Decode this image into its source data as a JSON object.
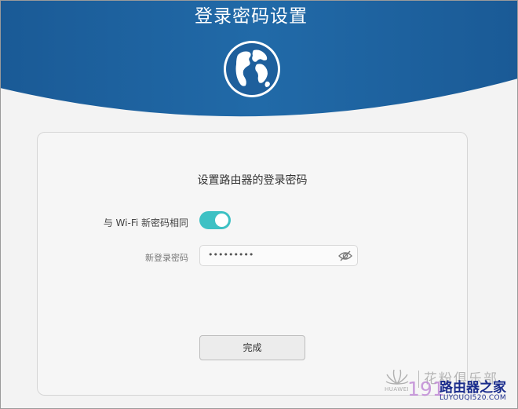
{
  "header": {
    "title": "登录密码设置",
    "bg_color": "#1e5f9c"
  },
  "card": {
    "subtitle": "设置路由器的登录密码",
    "wifi_same_toggle": {
      "label": "与 Wi-Fi 新密码相同",
      "on": true,
      "color": "#3ec1c4"
    },
    "password_field": {
      "label": "新登录密码",
      "value": "•••••••••",
      "icon": "eye-hidden-icon"
    },
    "done_button": "完成"
  },
  "watermark": {
    "vendor": "HUAWEI",
    "product_text": "花粉俱乐部",
    "number_text": "191",
    "brand": "路由器之家",
    "site": "LUYOUQI520.COM"
  }
}
